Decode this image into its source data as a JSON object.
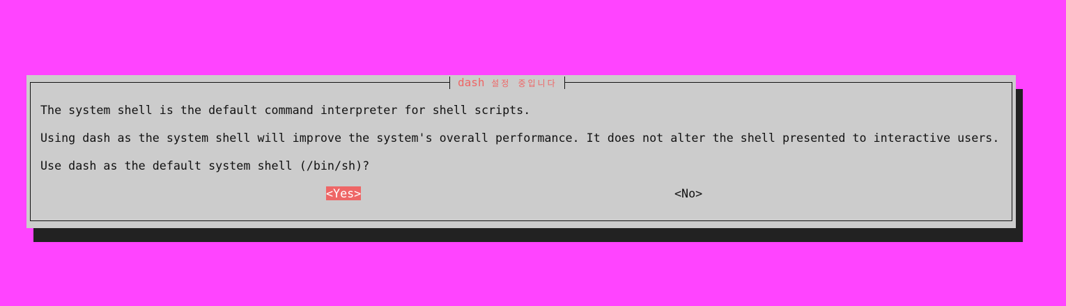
{
  "dialog": {
    "title_main": "dash",
    "title_sub": "설정 중입니다",
    "paragraph1": "The system shell is the default command interpreter for shell scripts.",
    "paragraph2": "Using dash as the system shell will improve the system's overall performance. It does not alter the shell presented to interactive users.",
    "question": "Use dash as the default system shell (/bin/sh)?",
    "yes_label": "<Yes>",
    "no_label": "<No>",
    "selected_button": "<Yes>"
  },
  "colors": {
    "background": "#ff44ff",
    "dialog": "#cccccc",
    "shadow": "#222222",
    "accent": "#ee6666"
  }
}
